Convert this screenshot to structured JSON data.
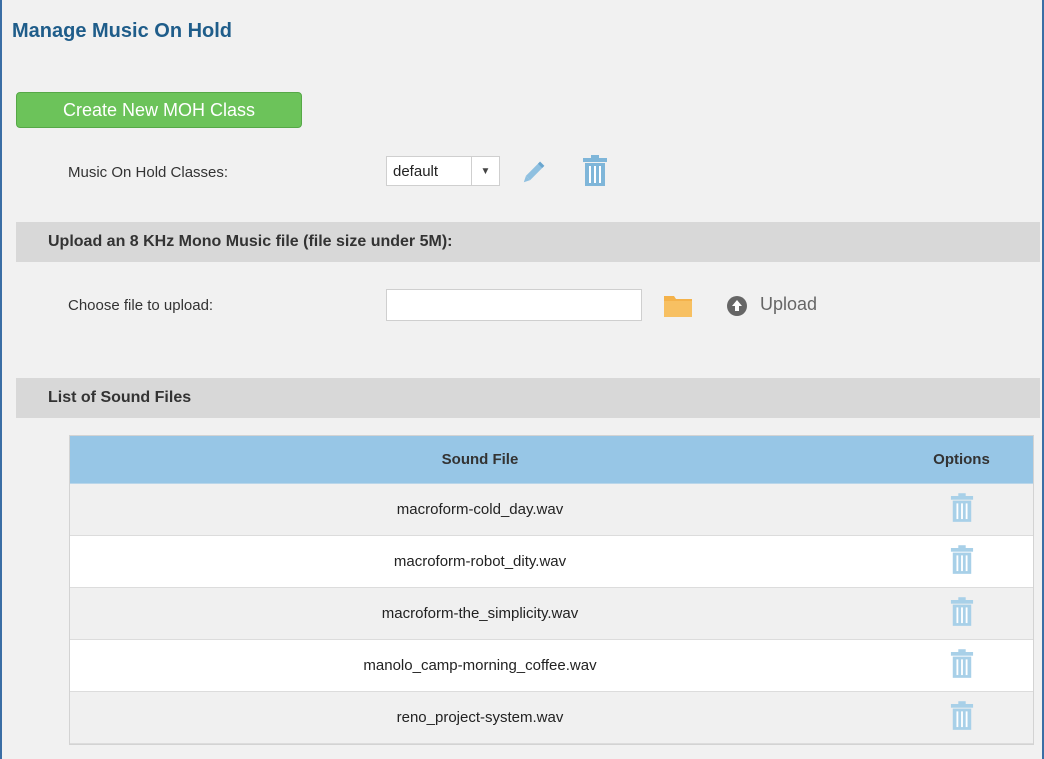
{
  "page": {
    "title": "Manage Music On Hold"
  },
  "actions": {
    "create_label": "Create New MOH Class"
  },
  "classes": {
    "label": "Music On Hold Classes:",
    "selected": "default",
    "edit_icon": "pencil-icon",
    "delete_icon": "trash-icon"
  },
  "upload": {
    "section_title": "Upload an 8 KHz Mono Music file (file size under 5M):",
    "choose_label": "Choose file to upload:",
    "file_value": "",
    "browse_icon": "folder-icon",
    "upload_label": "Upload",
    "upload_icon": "up-arrow-circle-icon"
  },
  "sound_files": {
    "section_title": "List of Sound Files",
    "columns": [
      "Sound File",
      "Options"
    ],
    "rows": [
      {
        "file": "macroform-cold_day.wav"
      },
      {
        "file": "macroform-robot_dity.wav"
      },
      {
        "file": "macroform-the_simplicity.wav"
      },
      {
        "file": "manolo_camp-morning_coffee.wav"
      },
      {
        "file": "reno_project-system.wav"
      }
    ]
  },
  "colors": {
    "title": "#1f5d8a",
    "create_button": "#6cc35a",
    "icon_blue": "#7fb6d9",
    "folder": "#f4b24a",
    "table_header": "#97c6e6",
    "section_bar": "#d8d8d8"
  }
}
